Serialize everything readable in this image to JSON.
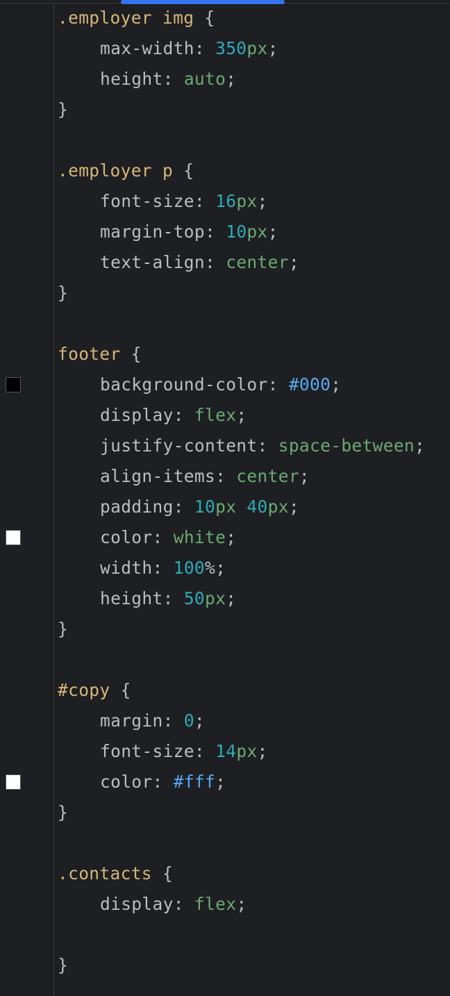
{
  "editor": {
    "colors": {
      "background": "#1e1f22",
      "selector": "#d5b778",
      "number": "#2aacb8",
      "keyword_value": "#6aab73",
      "hex_value": "#56a8f5",
      "text": "#bcbec4",
      "scroll_thumb": "#3574f0"
    },
    "rules": [
      {
        "selector": ".employer img",
        "declarations": [
          {
            "property": "max-width",
            "value": "350",
            "unit": "px"
          },
          {
            "property": "height",
            "value": "auto"
          }
        ]
      },
      {
        "selector": ".employer p",
        "declarations": [
          {
            "property": "font-size",
            "value": "16",
            "unit": "px"
          },
          {
            "property": "margin-top",
            "value": "10",
            "unit": "px"
          },
          {
            "property": "text-align",
            "value": "center"
          }
        ]
      },
      {
        "selector": "footer",
        "declarations": [
          {
            "property": "background-color",
            "value": "#000",
            "swatch": "#000000"
          },
          {
            "property": "display",
            "value": "flex"
          },
          {
            "property": "justify-content",
            "value": "space-between"
          },
          {
            "property": "align-items",
            "value": "center"
          },
          {
            "property": "padding",
            "value_a": "10",
            "unit_a": "px",
            "value_b": "40",
            "unit_b": "px"
          },
          {
            "property": "color",
            "value": "white",
            "swatch": "#ffffff"
          },
          {
            "property": "width",
            "value": "100",
            "unit": "%"
          },
          {
            "property": "height",
            "value": "50",
            "unit": "px"
          }
        ]
      },
      {
        "selector": "#copy",
        "declarations": [
          {
            "property": "margin",
            "value": "0"
          },
          {
            "property": "font-size",
            "value": "14",
            "unit": "px"
          },
          {
            "property": "color",
            "value": "#fff",
            "swatch": "#ffffff"
          }
        ]
      },
      {
        "selector": ".contacts",
        "declarations": [
          {
            "property": "display",
            "value": "flex"
          }
        ]
      }
    ]
  }
}
